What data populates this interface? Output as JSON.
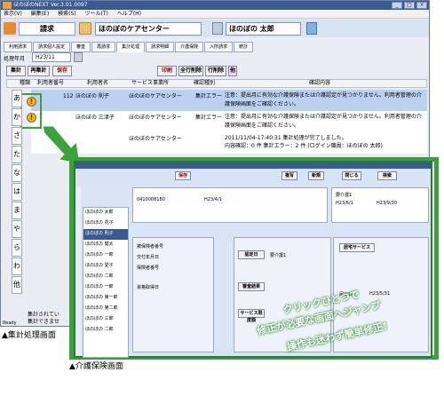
{
  "window": {
    "title": "ほのぼのNEXT Ver.3.01.0097",
    "min": "_",
    "max": "□",
    "close": "×"
  },
  "menu": [
    "表示(V)",
    "編集(E)",
    "検索(S)",
    "ツール(T)",
    "ヘルプ(H)"
  ],
  "toolbar": {
    "app_label": "請求",
    "office": "ほのぼのケアセンター",
    "user": "ほのぼの 太郎"
  },
  "tabs": [
    "利用請求",
    "請求個人設定",
    "審査",
    "再請求",
    "集計処理",
    "請求明細",
    "介護保険",
    "入所請求",
    "統計"
  ],
  "period": {
    "label": "処理年月",
    "value": "H23/11"
  },
  "buttons": {
    "aggregate": "集計",
    "reaggregate": "再集計",
    "save": "保存",
    "print": "印刷",
    "delete_all": "全行削除",
    "delete_row": "行削除",
    "other": "他"
  },
  "table": {
    "headers": [
      "種類",
      "利用者番号",
      "利用者名",
      "サービス事業所",
      "確認種別",
      "確認内容"
    ],
    "rows": [
      {
        "no": "112",
        "name": "ほのぼの 則子",
        "office": "ほのぼのケアセンター",
        "type": "集計エラー",
        "content": "注意：提出月に有効な介護保険または介護認定が見つかりません。利用者管理の介護保険画面をご確認ください。"
      },
      {
        "no": "",
        "name": "ほのぼの 三津子",
        "office": "ほのぼのケアセンター",
        "type": "集計エラー",
        "content": "注意：提出月に有効な介護保険または介護認定が見つかりません。利用者管理の介護保険画面をご確認ください。"
      },
      {
        "no": "",
        "name": "",
        "office": "ほのぼのケアセンター",
        "type": "",
        "content": "2011/11/04-17:40:31 集計処理が完了しました。"
      },
      {
        "no": "",
        "name": "",
        "office": "",
        "type": "",
        "content": "内容確認：0 件  集計エラー：2 件 (ログイン職員：ほのぼの 太郎)"
      }
    ]
  },
  "side_kana": [
    "あ",
    "か",
    "さ",
    "た",
    "な",
    "は",
    "ま",
    "や",
    "ら",
    "わ",
    "他"
  ],
  "status": [
    "集計されてい",
    "集計できませ"
  ],
  "ready": "Ready",
  "captions": {
    "left": "▲集計処理画面",
    "bottom": "▲介護保険画面"
  },
  "callout": {
    "line1": "クリックひとつで",
    "line2": "修正が必要な画面へジャンプ",
    "line3": "操作も迷わず簡単修正！"
  },
  "inner": {
    "save": "保存",
    "close": "閉じる",
    "copy": "複写",
    "new": "新規",
    "search": "検索",
    "users": [
      "ほのぼの 太郎",
      "ほのぼの 花子",
      "ほのぼの 則子",
      "ほのぼの 健太",
      "ほのぼの 一郎",
      "ほのぼの 愛子",
      "ほのぼの 二郎",
      "ほのぼの 一郎",
      "ほのぼの 第一郎",
      "ほのぼの 第二郎",
      "ほのぼの 三郎",
      "ほのぼの 二郎"
    ],
    "fields": [
      "被保険者番号",
      "交付年月日",
      "保険者番号",
      "資格取得日"
    ],
    "insurer": "0410008180",
    "kaigo": "要介護1",
    "dates": [
      "H23/4/1",
      "H23/5/31",
      "H23/6/1",
      "H23/9/30"
    ],
    "buttons2": [
      "認定日",
      "認定結果",
      "審査結果",
      "サービス限度額",
      "居宅サービス",
      "届出日",
      "サービス限度"
    ],
    "nin": "要介護1"
  }
}
